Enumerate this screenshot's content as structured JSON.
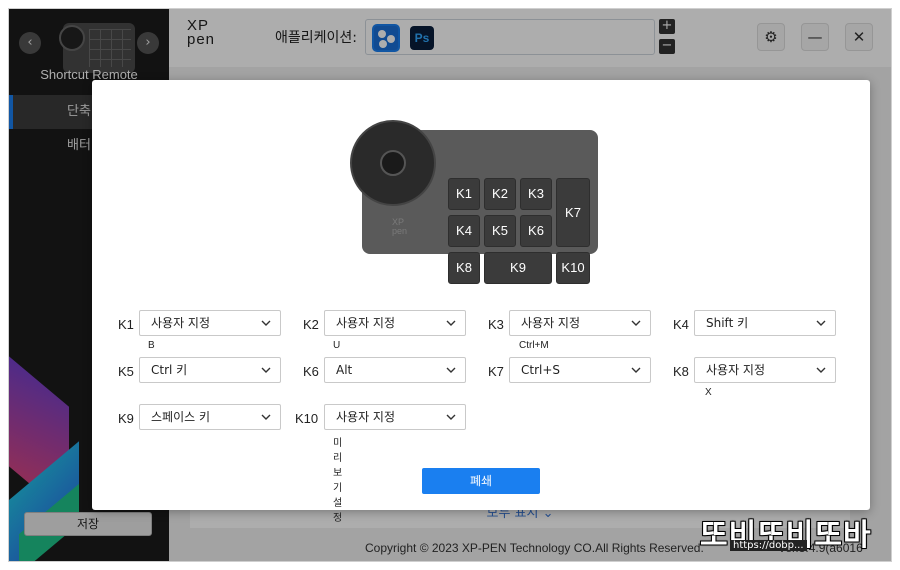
{
  "sidebar": {
    "device_name": "Shortcut Remote",
    "items": [
      {
        "label": "단축"
      },
      {
        "label": "배터"
      }
    ],
    "save_label": "저장"
  },
  "header": {
    "logo_line1": "XP",
    "logo_line2": "pen",
    "app_label": "애플리케이션:",
    "ps_icon_text": "Ps",
    "plus": "+",
    "minus": "−",
    "settings_icon": "⚙",
    "minimize_icon": "—",
    "close_icon": "✕"
  },
  "main": {
    "show_all": "모두 표시",
    "copyright": "Copyright © 2023  XP-PEN Technology CO.All Rights Reserved.",
    "version": "Ver.3.4.9(a6016"
  },
  "watermark": {
    "text": "또비또비또바",
    "sub": "https://dobp..."
  },
  "modal": {
    "device_brand_line1": "XP",
    "device_brand_line2": "pen",
    "keys": [
      "K1",
      "K2",
      "K3",
      "K4",
      "K5",
      "K6",
      "K7",
      "K8",
      "K9",
      "K10"
    ],
    "assignments": [
      {
        "key": "K1",
        "value": "사용자 지정",
        "sub": "B"
      },
      {
        "key": "K2",
        "value": "사용자 지정",
        "sub": "U"
      },
      {
        "key": "K3",
        "value": "사용자 지정",
        "sub": "Ctrl+M"
      },
      {
        "key": "K4",
        "value": "Shift 키",
        "sub": ""
      },
      {
        "key": "K5",
        "value": "Ctrl 키",
        "sub": ""
      },
      {
        "key": "K6",
        "value": "Alt",
        "sub": ""
      },
      {
        "key": "K7",
        "value": "Ctrl+S",
        "sub": ""
      },
      {
        "key": "K8",
        "value": "사용자 지정",
        "sub": "X"
      },
      {
        "key": "K9",
        "value": "스페이스 키",
        "sub": ""
      },
      {
        "key": "K10",
        "value": "사용자 지정",
        "sub": "미리 보기 설정"
      }
    ],
    "close_label": "폐쇄"
  },
  "colors": {
    "accent": "#1a7ff0",
    "sidebar_bg": "#1b1b1b",
    "device_body": "#5a5a5a"
  }
}
